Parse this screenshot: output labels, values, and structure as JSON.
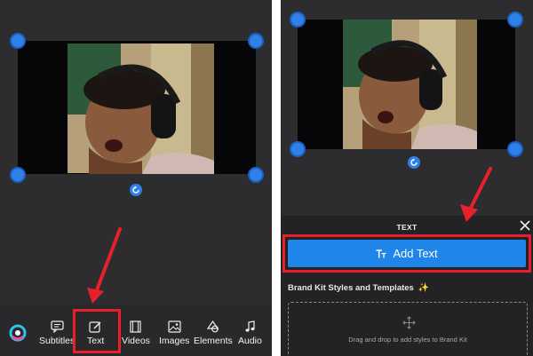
{
  "toolbar": {
    "items": [
      {
        "label": "Subtitles",
        "icon": "subtitles-icon"
      },
      {
        "label": "Text",
        "icon": "text-edit-icon"
      },
      {
        "label": "Videos",
        "icon": "film-icon"
      },
      {
        "label": "Images",
        "icon": "image-icon"
      },
      {
        "label": "Elements",
        "icon": "shapes-icon"
      },
      {
        "label": "Audio",
        "icon": "music-note-icon"
      }
    ],
    "highlighted": "Text"
  },
  "text_panel": {
    "title": "TEXT",
    "add_text_label": "Add Text",
    "brand_kit_heading": "Brand Kit Styles and Templates",
    "sparkle": "✨",
    "dropzone_hint": "Drag and drop to add styles to Brand Kit"
  },
  "colors": {
    "accent_blue": "#1f85e8",
    "handle_blue": "#2f80e8",
    "annotation_red": "#e8202b",
    "panel_bg": "#2d2d2f"
  }
}
